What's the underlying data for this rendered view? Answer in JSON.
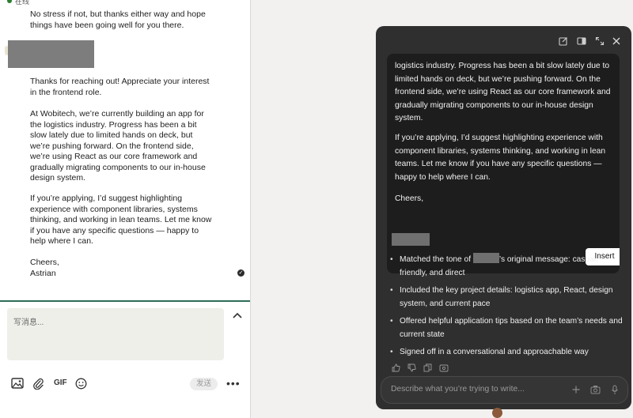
{
  "chat": {
    "status": "在线",
    "previous_message": "No stress if not, but thanks either way and hope\nthings have been going well for you there.",
    "message_paragraphs": [
      "Thanks for reaching out! Appreciate your interest\nin the frontend role.",
      "At Wobitech, we’re currently building an app for\nthe logistics industry. Progress has been a bit\nslow lately due to limited hands on deck, but\nwe’re pushing forward. On the frontend side,\nwe’re using React as our core framework and\ngradually migrating components to our in-house\ndesign system.",
      "If you’re applying, I’d suggest highlighting\nexperience with component libraries, systems\nthinking, and working in lean teams. Let me know\nif you have any specific questions — happy to\nhelp where I can.",
      "Cheers,\nAstrian"
    ],
    "compose_placeholder": "写消息...",
    "gif_label": "GIF",
    "send_label": "发送",
    "more_label": "•••"
  },
  "ai_panel": {
    "draft_paragraphs": [
      "logistics industry. Progress has been a bit slow lately due to limited hands on deck, but we’re pushing forward. On the frontend side, we’re using React as our core framework and gradually migrating components to our in-house design system.",
      "If you’re applying, I’d suggest highlighting experience with component libraries, systems thinking, and working in lean teams. Let me know if you have any specific questions — happy to help where I can.",
      "Cheers,"
    ],
    "insert_label": "Insert",
    "bullet_1_before": "Matched the tone of ",
    "bullet_1_after": "’s original message: casual, friendly, and direct",
    "bullets_rest": [
      "Included the key project details: logistics app, React, design system, and current pace",
      "Offered helpful application tips based on the team’s needs and current state",
      "Signed off in a conversational and approachable way"
    ],
    "input_placeholder": "Describe what you’re trying to write...",
    "accent_color": "#2d6e55"
  }
}
